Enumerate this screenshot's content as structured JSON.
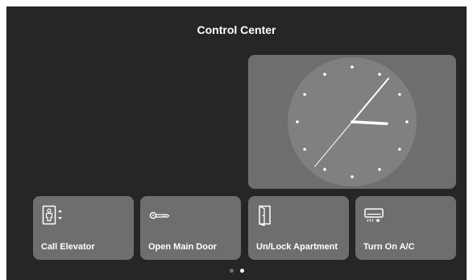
{
  "header": {
    "title": "Control Center"
  },
  "clock": {
    "hour_hand_angle_deg": 93,
    "minute_hand_angle_deg": 40,
    "second_hand_angle_deg": 220
  },
  "actions": [
    {
      "label": "Call Elevator",
      "icon": "elevator-icon"
    },
    {
      "label": "Open Main Door",
      "icon": "key-icon"
    },
    {
      "label": "Un/Lock Apartment",
      "icon": "door-icon"
    },
    {
      "label": "Turn On A/C",
      "icon": "air-conditioner-icon"
    }
  ],
  "pagination": {
    "page_count": 2,
    "current_page": 2
  },
  "colors": {
    "screen_background": "#262626",
    "panel": "#6e6e6e",
    "clock_face": "#808080",
    "text": "#ffffff"
  }
}
